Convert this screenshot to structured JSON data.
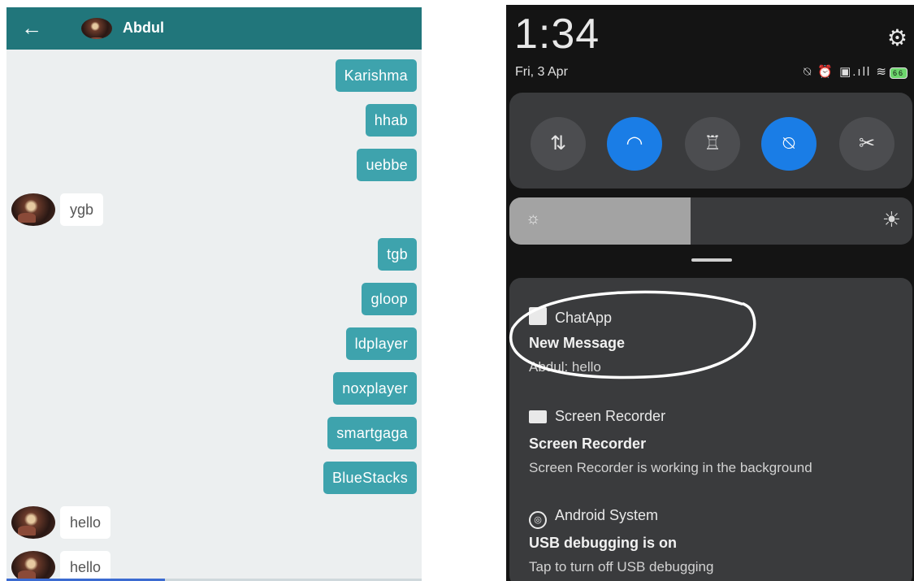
{
  "chat": {
    "header": {
      "back_icon": "arrow-left-icon",
      "back_glyph": "←",
      "contact_name": "Abdul"
    },
    "messages": [
      {
        "direction": "out",
        "text": "Karishma"
      },
      {
        "direction": "out",
        "text": "hhab"
      },
      {
        "direction": "out",
        "text": "uebbe"
      },
      {
        "direction": "in",
        "text": "ygb"
      },
      {
        "direction": "out",
        "text": "tgb"
      },
      {
        "direction": "out",
        "text": "gloop"
      },
      {
        "direction": "out",
        "text": "ldplayer"
      },
      {
        "direction": "out",
        "text": "noxplayer"
      },
      {
        "direction": "out",
        "text": "smartgaga"
      },
      {
        "direction": "out",
        "text": "BlueStacks"
      },
      {
        "direction": "in",
        "text": "hello"
      },
      {
        "direction": "in",
        "text": "hello"
      }
    ],
    "colors": {
      "header": "#21767b",
      "outgoing_bubble": "#3ea3ad",
      "incoming_bubble": "#ffffff"
    }
  },
  "phone": {
    "time": "1:34",
    "date": "Fri, 3 Apr",
    "settings_icon": "gear-icon",
    "status_icons_text": "⍉ ⏰ ▣.ıll ≋",
    "battery_level": "66",
    "quick_toggles": [
      {
        "name": "mobile-data",
        "glyph": "⇅",
        "on": false
      },
      {
        "name": "wifi",
        "glyph": "◠",
        "on": true
      },
      {
        "name": "flashlight",
        "glyph": "♖",
        "on": false
      },
      {
        "name": "silent",
        "glyph": "⍉",
        "on": true
      },
      {
        "name": "screenshot",
        "glyph": "✂",
        "on": false
      }
    ],
    "brightness_fraction": 0.45,
    "notifications": [
      {
        "app": "ChatApp",
        "title": "New Message",
        "text": "Abdul: hello"
      },
      {
        "app": "Screen Recorder",
        "title": "Screen Recorder",
        "text": "Screen Recorder is working in the background"
      },
      {
        "app": "Android System",
        "title": "USB debugging is on",
        "text": "Tap to turn off USB debugging"
      }
    ],
    "colors": {
      "toggle_on": "#1a7de6",
      "panel": "#3a3b3d",
      "background": "#141414"
    }
  }
}
